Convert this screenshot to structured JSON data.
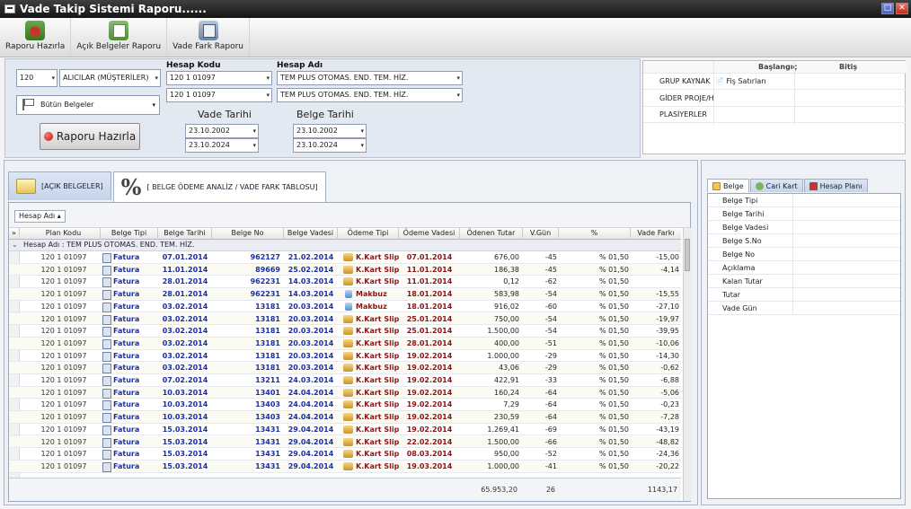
{
  "window": {
    "title": "Vade Takip Sistemi Raporu......",
    "minimize": "□",
    "close": "✕"
  },
  "toolbar": {
    "report_btn": "Raporu Hazırla",
    "open_docs_btn": "Açık Belgeler Raporu",
    "diff_btn": "Vade Fark Raporu"
  },
  "filters": {
    "code": "120",
    "account_type": "ALICILAR (MÜŞTERİLER)",
    "account_code_label": "Hesap Kodu",
    "account_code_from": "120 1 01097",
    "account_code_to": "120 1 01097",
    "account_name_label": "Hesap Adı",
    "account_name_from": "TEM PLUS OTOMAS. END. TEM. HİZ.",
    "account_name_to": "TEM PLUS OTOMAS. END. TEM. HİZ.",
    "doc_type": "Bütün Belgeler",
    "due_date_label": "Vade Tarihi",
    "due_from": "23.10.2002",
    "due_to": "23.10.2024",
    "doc_date_label": "Belge Tarihi",
    "doc_from": "23.10.2002",
    "doc_to": "23.10.2024",
    "report_btn": "Raporu Hazırla"
  },
  "range_panel": {
    "start_label": "Başlangıç",
    "end_label": "Bitiş",
    "rows": [
      "GRUP KAYNAK",
      "GİDER PROJE/H",
      "PLASİYERLER"
    ],
    "grup_value": "Fiş Satırları"
  },
  "tabs": {
    "open_docs": "[AÇIK BELGELER]",
    "analysis": "[ BELGE ÖDEME ANALİZ / VADE FARK TABLOSU]"
  },
  "grid": {
    "group_by": "Hesap Adı",
    "columns": [
      "Plan Kodu",
      "Belge Tipi",
      "Belge Tarihi",
      "Belge No",
      "Belge Vadesi",
      "Ödeme Tipi",
      "Ödeme Vadesi",
      "Ödenen Tutar",
      "V.Gün",
      "%",
      "Vade Farkı"
    ],
    "group_row": "Hesap Adı : TEM PLUS OTOMAS. END. TEM. HİZ.",
    "rows": [
      {
        "plan": "120 1 01097",
        "tip": "Fatura",
        "btar": "07.01.2014",
        "bno": "962127",
        "bvad": "21.02.2014",
        "otip": "K.Kart Slip",
        "ovad": "07.01.2014",
        "otut": "676,00",
        "vgun": "-45",
        "pct": "% 01,50",
        "vf": "-15,00"
      },
      {
        "plan": "120 1 01097",
        "tip": "Fatura",
        "btar": "11.01.2014",
        "bno": "89669",
        "bvad": "25.02.2014",
        "otip": "K.Kart Slip",
        "ovad": "11.01.2014",
        "otut": "186,38",
        "vgun": "-45",
        "pct": "% 01,50",
        "vf": "-4,14"
      },
      {
        "plan": "120 1 01097",
        "tip": "Fatura",
        "btar": "28.01.2014",
        "bno": "962231",
        "bvad": "14.03.2014",
        "otip": "K.Kart Slip",
        "ovad": "11.01.2014",
        "otut": "0,12",
        "vgun": "-62",
        "pct": "% 01,50",
        "vf": ""
      },
      {
        "plan": "120 1 01097",
        "tip": "Fatura",
        "btar": "28.01.2014",
        "bno": "962231",
        "bvad": "14.03.2014",
        "otip": "Makbuz",
        "ovad": "18.01.2014",
        "otut": "583,98",
        "vgun": "-54",
        "pct": "% 01,50",
        "vf": "-15,55"
      },
      {
        "plan": "120 1 01097",
        "tip": "Fatura",
        "btar": "03.02.2014",
        "bno": "13181",
        "bvad": "20.03.2014",
        "otip": "Makbuz",
        "ovad": "18.01.2014",
        "otut": "916,02",
        "vgun": "-60",
        "pct": "% 01,50",
        "vf": "-27,10"
      },
      {
        "plan": "120 1 01097",
        "tip": "Fatura",
        "btar": "03.02.2014",
        "bno": "13181",
        "bvad": "20.03.2014",
        "otip": "K.Kart Slip",
        "ovad": "25.01.2014",
        "otut": "750,00",
        "vgun": "-54",
        "pct": "% 01,50",
        "vf": "-19,97"
      },
      {
        "plan": "120 1 01097",
        "tip": "Fatura",
        "btar": "03.02.2014",
        "bno": "13181",
        "bvad": "20.03.2014",
        "otip": "K.Kart Slip",
        "ovad": "25.01.2014",
        "otut": "1.500,00",
        "vgun": "-54",
        "pct": "% 01,50",
        "vf": "-39,95"
      },
      {
        "plan": "120 1 01097",
        "tip": "Fatura",
        "btar": "03.02.2014",
        "bno": "13181",
        "bvad": "20.03.2014",
        "otip": "K.Kart Slip",
        "ovad": "28.01.2014",
        "otut": "400,00",
        "vgun": "-51",
        "pct": "% 01,50",
        "vf": "-10,06"
      },
      {
        "plan": "120 1 01097",
        "tip": "Fatura",
        "btar": "03.02.2014",
        "bno": "13181",
        "bvad": "20.03.2014",
        "otip": "K.Kart Slip",
        "ovad": "19.02.2014",
        "otut": "1.000,00",
        "vgun": "-29",
        "pct": "% 01,50",
        "vf": "-14,30"
      },
      {
        "plan": "120 1 01097",
        "tip": "Fatura",
        "btar": "03.02.2014",
        "bno": "13181",
        "bvad": "20.03.2014",
        "otip": "K.Kart Slip",
        "ovad": "19.02.2014",
        "otut": "43,06",
        "vgun": "-29",
        "pct": "% 01,50",
        "vf": "-0,62"
      },
      {
        "plan": "120 1 01097",
        "tip": "Fatura",
        "btar": "07.02.2014",
        "bno": "13211",
        "bvad": "24.03.2014",
        "otip": "K.Kart Slip",
        "ovad": "19.02.2014",
        "otut": "422,91",
        "vgun": "-33",
        "pct": "% 01,50",
        "vf": "-6,88"
      },
      {
        "plan": "120 1 01097",
        "tip": "Fatura",
        "btar": "10.03.2014",
        "bno": "13401",
        "bvad": "24.04.2014",
        "otip": "K.Kart Slip",
        "ovad": "19.02.2014",
        "otut": "160,24",
        "vgun": "-64",
        "pct": "% 01,50",
        "vf": "-5,06"
      },
      {
        "plan": "120 1 01097",
        "tip": "Fatura",
        "btar": "10.03.2014",
        "bno": "13403",
        "bvad": "24.04.2014",
        "otip": "K.Kart Slip",
        "ovad": "19.02.2014",
        "otut": "7,29",
        "vgun": "-64",
        "pct": "% 01,50",
        "vf": "-0,23"
      },
      {
        "plan": "120 1 01097",
        "tip": "Fatura",
        "btar": "10.03.2014",
        "bno": "13403",
        "bvad": "24.04.2014",
        "otip": "K.Kart Slip",
        "ovad": "19.02.2014",
        "otut": "230,59",
        "vgun": "-64",
        "pct": "% 01,50",
        "vf": "-7,28"
      },
      {
        "plan": "120 1 01097",
        "tip": "Fatura",
        "btar": "15.03.2014",
        "bno": "13431",
        "bvad": "29.04.2014",
        "otip": "K.Kart Slip",
        "ovad": "19.02.2014",
        "otut": "1.269,41",
        "vgun": "-69",
        "pct": "% 01,50",
        "vf": "-43,19"
      },
      {
        "plan": "120 1 01097",
        "tip": "Fatura",
        "btar": "15.03.2014",
        "bno": "13431",
        "bvad": "29.04.2014",
        "otip": "K.Kart Slip",
        "ovad": "22.02.2014",
        "otut": "1.500,00",
        "vgun": "-66",
        "pct": "% 01,50",
        "vf": "-48,82"
      },
      {
        "plan": "120 1 01097",
        "tip": "Fatura",
        "btar": "15.03.2014",
        "bno": "13431",
        "bvad": "29.04.2014",
        "otip": "K.Kart Slip",
        "ovad": "08.03.2014",
        "otut": "950,00",
        "vgun": "-52",
        "pct": "% 01,50",
        "vf": "-24,36"
      },
      {
        "plan": "120 1 01097",
        "tip": "Fatura",
        "btar": "15.03.2014",
        "bno": "13431",
        "bvad": "29.04.2014",
        "otip": "K.Kart Slip",
        "ovad": "19.03.2014",
        "otut": "1.000,00",
        "vgun": "-41",
        "pct": "% 01,50",
        "vf": "-20,22"
      }
    ],
    "footer": {
      "total_paid": "65.953,20",
      "total_days": "26",
      "total_diff": "1143,17"
    }
  },
  "side": {
    "tabs": [
      "Belge",
      "Cari Kart",
      "Hesap Planı"
    ],
    "fields": [
      "Belge Tipi",
      "Belge Tarihi",
      "Belge Vadesi",
      "Belge S.No",
      "Belge No",
      "Açıklama",
      "Kalan Tutar",
      "Tutar",
      "Vade Gün"
    ]
  }
}
